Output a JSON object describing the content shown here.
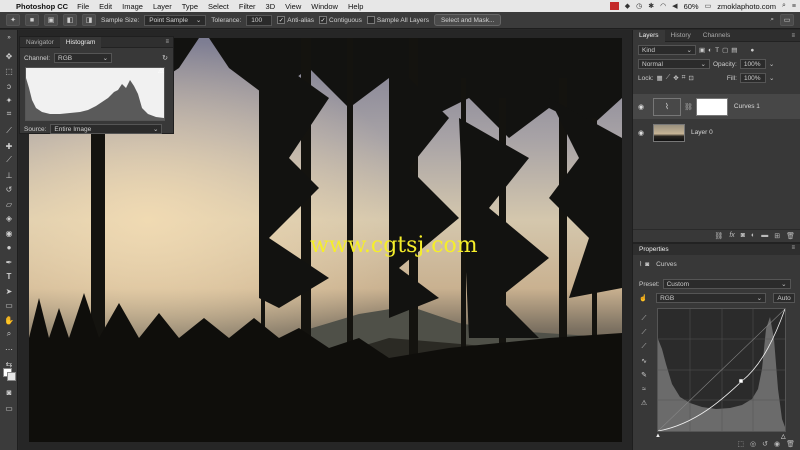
{
  "menubar": {
    "app_name": "Photoshop CC",
    "items": [
      "File",
      "Edit",
      "Image",
      "Layer",
      "Type",
      "Select",
      "Filter",
      "3D",
      "View",
      "Window",
      "Help"
    ],
    "battery": "60%",
    "user": "zmoklaphoto.com"
  },
  "options": {
    "sample_size_label": "Sample Size:",
    "sample_size_value": "Point Sample",
    "tolerance_label": "Tolerance:",
    "tolerance_value": "100",
    "anti_alias": "Anti-alias",
    "contiguous": "Contiguous",
    "sample_all_layers": "Sample All Layers",
    "select_mask_button": "Select and Mask..."
  },
  "histogram_panel": {
    "tabs": [
      "Navigator",
      "Histogram"
    ],
    "active_tab": "Histogram",
    "channel_label": "Channel:",
    "channel_value": "RGB",
    "source_label": "Source:",
    "source_value": "Entire Image"
  },
  "layers_panel": {
    "tabs": [
      "Layers",
      "History",
      "Channels"
    ],
    "kind_filter": "Kind",
    "blend_mode": "Normal",
    "opacity_label": "Opacity:",
    "opacity_value": "100%",
    "lock_label": "Lock:",
    "fill_label": "Fill:",
    "fill_value": "100%",
    "layers": [
      {
        "name": "Curves 1"
      },
      {
        "name": "Layer 0"
      }
    ]
  },
  "properties_panel": {
    "title": "Properties",
    "adjustment": "Curves",
    "preset_label": "Preset:",
    "preset_value": "Custom",
    "channel_value": "RGB",
    "auto_button": "Auto"
  },
  "watermark": "www.cgtsj.com",
  "colors": {
    "accent_yellow": "#f5ee2a",
    "panel": "#383838",
    "chrome": "#3b3b3b"
  }
}
